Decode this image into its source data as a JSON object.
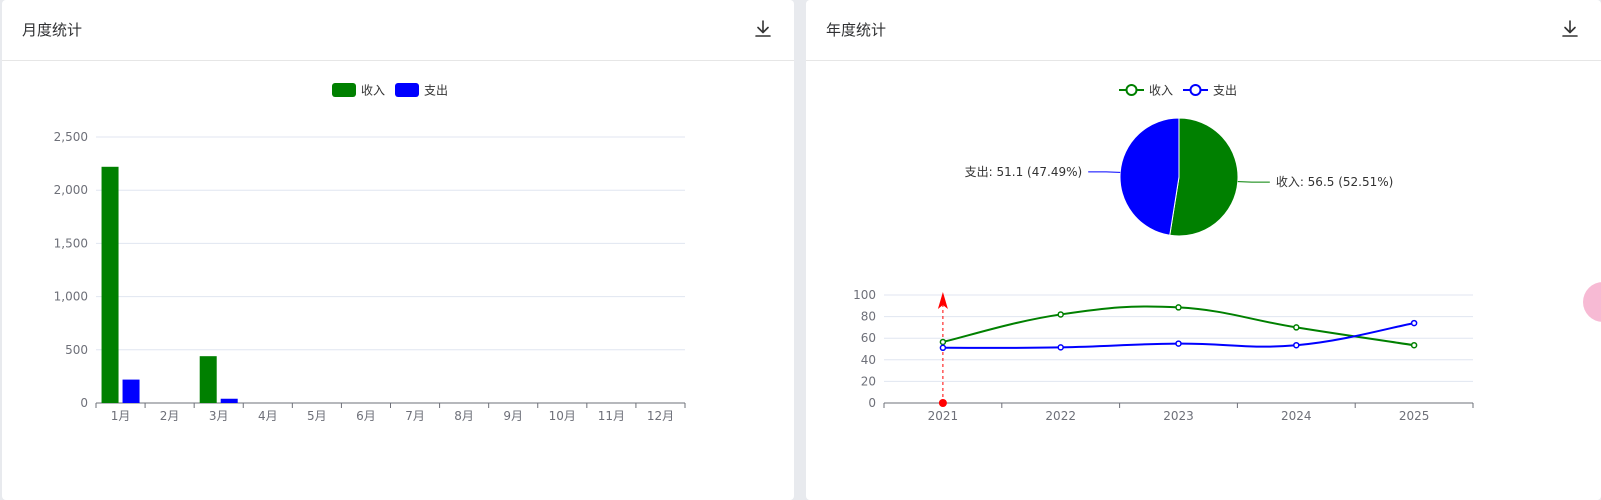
{
  "monthly": {
    "title": "月度统计",
    "download_icon": "download-icon"
  },
  "yearly": {
    "title": "年度统计",
    "download_icon": "download-icon"
  },
  "colors": {
    "income": "#008000",
    "expense": "#0000ff",
    "marker": "#ff0000"
  },
  "chart_data": [
    {
      "type": "bar",
      "legend": [
        "收入",
        "支出"
      ],
      "legend_position": "top-center",
      "categories": [
        "1月",
        "2月",
        "3月",
        "4月",
        "5月",
        "6月",
        "7月",
        "8月",
        "9月",
        "10月",
        "11月",
        "12月"
      ],
      "series": [
        {
          "name": "收入",
          "values": [
            2220,
            0,
            440,
            0,
            0,
            0,
            0,
            0,
            0,
            0,
            0,
            0
          ]
        },
        {
          "name": "支出",
          "values": [
            220,
            0,
            40,
            0,
            0,
            0,
            0,
            0,
            0,
            0,
            0,
            0
          ]
        }
      ],
      "ylim": [
        0,
        2500
      ],
      "yticks": [
        "0",
        "500",
        "1,000",
        "1,500",
        "2,000",
        "2,500"
      ],
      "grid": true
    },
    {
      "type": "pie",
      "slices": [
        {
          "name": "收入",
          "value": 56.5,
          "label": "收入: 56.5 (52.51%)"
        },
        {
          "name": "支出",
          "value": 51.1,
          "label": "支出: 51.1 (47.49%)"
        }
      ]
    },
    {
      "type": "line",
      "legend": [
        "收入",
        "支出"
      ],
      "legend_position": "top-center",
      "x": [
        "2021",
        "2022",
        "2023",
        "2024",
        "2025"
      ],
      "series": [
        {
          "name": "收入",
          "values": [
            56.5,
            82,
            88.5,
            70,
            53.5
          ]
        },
        {
          "name": "支出",
          "values": [
            51.1,
            51.5,
            55,
            53.5,
            74
          ]
        }
      ],
      "ylim": [
        0,
        100
      ],
      "yticks": [
        "0",
        "20",
        "40",
        "60",
        "80",
        "100"
      ],
      "marker_at": "2021",
      "grid": true
    }
  ]
}
